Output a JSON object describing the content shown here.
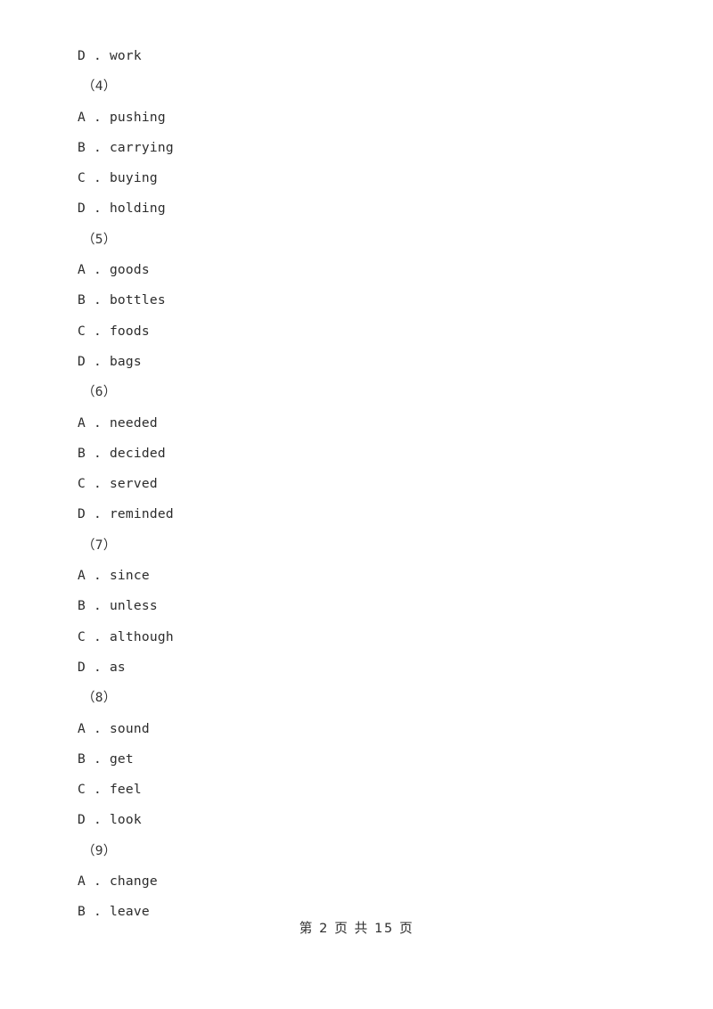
{
  "document": {
    "page_background": "#ffffff",
    "text_color": "#2b2b2b",
    "lines": [
      {
        "type": "option",
        "text": "D . work"
      },
      {
        "type": "qnum",
        "text": "（4）"
      },
      {
        "type": "option",
        "text": "A . pushing"
      },
      {
        "type": "option",
        "text": "B . carrying"
      },
      {
        "type": "option",
        "text": "C . buying"
      },
      {
        "type": "option",
        "text": "D . holding"
      },
      {
        "type": "qnum",
        "text": "（5）"
      },
      {
        "type": "option",
        "text": "A . goods"
      },
      {
        "type": "option",
        "text": "B . bottles"
      },
      {
        "type": "option",
        "text": "C . foods"
      },
      {
        "type": "option",
        "text": "D . bags"
      },
      {
        "type": "qnum",
        "text": "（6）"
      },
      {
        "type": "option",
        "text": "A . needed"
      },
      {
        "type": "option",
        "text": "B . decided"
      },
      {
        "type": "option",
        "text": "C . served"
      },
      {
        "type": "option",
        "text": "D . reminded"
      },
      {
        "type": "qnum",
        "text": "（7）"
      },
      {
        "type": "option",
        "text": "A . since"
      },
      {
        "type": "option",
        "text": "B . unless"
      },
      {
        "type": "option",
        "text": "C . although"
      },
      {
        "type": "option",
        "text": "D . as"
      },
      {
        "type": "qnum",
        "text": "（8）"
      },
      {
        "type": "option",
        "text": "A . sound"
      },
      {
        "type": "option",
        "text": "B . get"
      },
      {
        "type": "option",
        "text": "C . feel"
      },
      {
        "type": "option",
        "text": "D . look"
      },
      {
        "type": "qnum",
        "text": "（9）"
      },
      {
        "type": "option",
        "text": "A . change"
      },
      {
        "type": "option",
        "text": "B . leave"
      }
    ],
    "footer": {
      "text": "第 2 页 共 15 页",
      "current_page": "2",
      "total_pages": "15"
    }
  }
}
